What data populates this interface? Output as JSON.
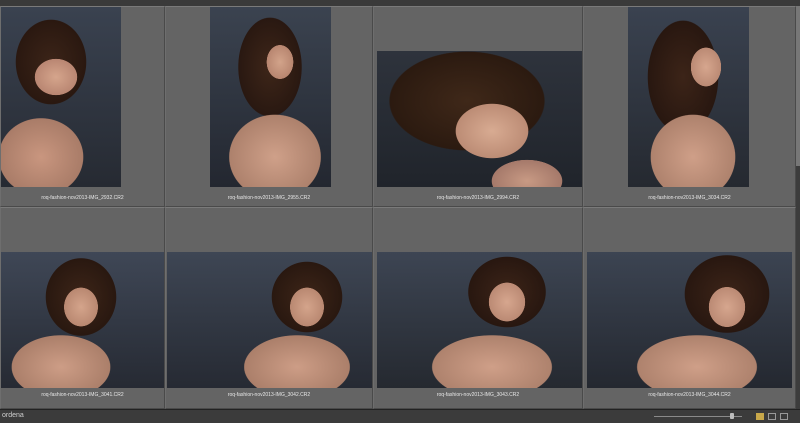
{
  "photos": [
    {
      "filename": "roq-fashion-nov2013-IMG_2932.CR2"
    },
    {
      "filename": "roq-fashion-nov2013-IMG_2955.CR2"
    },
    {
      "filename": "roq-fashion-nov2013-IMG_2994.CR2"
    },
    {
      "filename": "roq-fashion-nov2013-IMG_3034.CR2"
    },
    {
      "filename": "roq-fashion-nov2013-IMG_3041.CR2"
    },
    {
      "filename": "roq-fashion-nov2013-IMG_3042.CR2"
    },
    {
      "filename": "roq-fashion-nov2013-IMG_3043.CR2"
    },
    {
      "filename": "roq-fashion-nov2013-IMG_3044.CR2"
    }
  ],
  "statusbar": {
    "left_text": "ordena",
    "zoom_icon": "zoom-slider"
  },
  "colors": {
    "cell_bg": "#646464",
    "photo_bg": "#2c3038",
    "skin": "#c99a82",
    "hair": "#3a2418"
  }
}
